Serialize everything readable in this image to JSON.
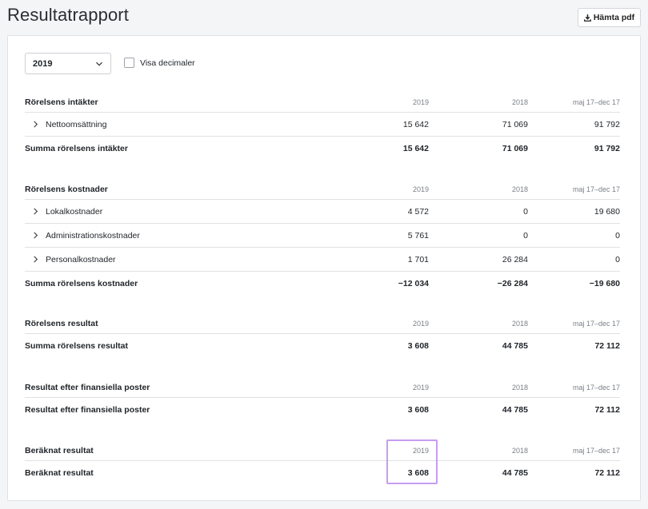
{
  "page": {
    "title": "Resultatrapport",
    "pdf_button": "Hämta pdf"
  },
  "filters": {
    "year": "2019",
    "show_decimals_label": "Visa decimaler"
  },
  "columns": [
    "2019",
    "2018",
    "maj 17–dec 17"
  ],
  "sections": [
    {
      "title": "Rörelsens intäkter",
      "items": [
        {
          "label": "Nettoomsättning",
          "values": [
            "15 642",
            "71 069",
            "91 792"
          ]
        }
      ],
      "sum": {
        "label": "Summa rörelsens intäkter",
        "values": [
          "15 642",
          "71 069",
          "91 792"
        ]
      }
    },
    {
      "title": "Rörelsens kostnader",
      "items": [
        {
          "label": "Lokalkostnader",
          "values": [
            "4 572",
            "0",
            "19 680"
          ]
        },
        {
          "label": "Administrationskostnader",
          "values": [
            "5 761",
            "0",
            "0"
          ]
        },
        {
          "label": "Personalkostnader",
          "values": [
            "1 701",
            "26 284",
            "0"
          ]
        }
      ],
      "sum": {
        "label": "Summa rörelsens kostnader",
        "values": [
          "−12 034",
          "−26 284",
          "−19 680"
        ]
      }
    },
    {
      "title": "Rörelsens resultat",
      "items": [],
      "sum": {
        "label": "Summa rörelsens resultat",
        "values": [
          "3 608",
          "44 785",
          "72 112"
        ]
      }
    },
    {
      "title": "Resultat efter finansiella poster",
      "items": [],
      "sum": {
        "label": "Resultat efter finansiella poster",
        "values": [
          "3 608",
          "44 785",
          "72 112"
        ]
      }
    },
    {
      "title": "Beräknat resultat",
      "items": [],
      "sum": {
        "label": "Beräknat resultat",
        "values": [
          "3 608",
          "44 785",
          "72 112"
        ]
      }
    }
  ],
  "colors": {
    "highlight": "#c79cf0"
  }
}
